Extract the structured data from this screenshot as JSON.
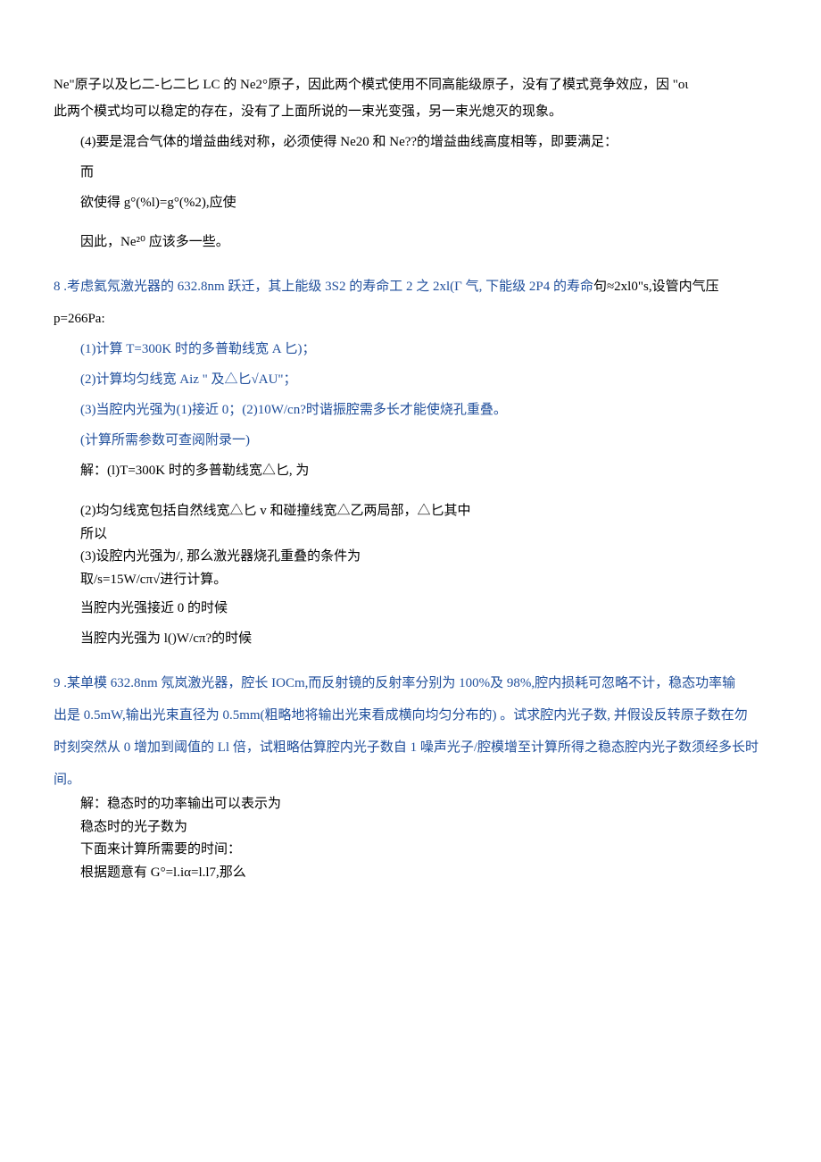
{
  "lines": {
    "l1": "Ne\"原子以及匕二-匕二匕 LC 的 Ne2°原子，因此两个模式使用不同高能级原子，没有了模式竞争效应，因 \"οι",
    "l2": "此两个模式均可以稳定的存在，没有了上面所说的一束光变强，另一束光熄灭的现象。",
    "l3": "(4)要是混合气体的增益曲线对称，必须使得 Ne20 和 Ne??的增益曲线高度相等，即要满足：",
    "l4": "而",
    "l5": "欲使得 g°(%l)=g°(%2),应使",
    "l6": "因此，Ne²⁰ 应该多一些。",
    "q8_num": "8",
    "q8_a": " .考虑氦氖激光器的 632.8nm 跃迁，其上能级 3S2 的寿命工 2 之 2xl(Γ 气, 下能级 2P4 的寿命",
    "q8_b": "句≈2xl0\"s,设管内气压",
    "q8_c": "p=266Pa:",
    "q8_1": "(1)计算 T=300K 时的多普勒线宽 A 匕)；",
    "q8_2": "(2)计算均匀线宽 Aiz \" 及△匕√AU\"；",
    "q8_3": "(3)当腔内光强为(1)接近 0；(2)10W/cn?时谐振腔需多长才能使烧孔重叠。",
    "q8_4": "(计算所需参数可查阅附录一)",
    "q8_sol1": "解：(l)T=300K 时的多普勒线宽△匕, 为",
    "q8_sol2": "(2)均匀线宽包括自然线宽△匕 v 和碰撞线宽△乙两局部，△匕其中",
    "q8_sol3": "所以",
    "q8_sol4": "(3)设腔内光强为/, 那么激光器烧孔重叠的条件为",
    "q8_sol5": "取/s=15W/cπ√进行计算。",
    "q8_sol6": "当腔内光强接近 0 的时候",
    "q8_sol7": "当腔内光强为 l()W/cπ?的时候",
    "q9_num": "9",
    "q9_a": " .某单模 632.8nm 氖岚激光器，腔长 IOCm,而反射镜的反射率分别为 100%及 98%,腔内损耗可忽略不计，稳态功率输",
    "q9_b": "出是 0.5mW,输出光束直径为 0.5mm(粗略地将输出光束看成横向均匀分布的) 。试求腔内光子数, 并假设反转原子数在勿",
    "q9_c": "时刻突然从 0 增加到阈值的 Ll 倍，试粗略估算腔内光子数自 1 噪声光子/腔模增至计算所得之稳态腔内光子数须经多长时",
    "q9_d": "间。",
    "q9_sol1": "解：稳态时的功率输出可以表示为",
    "q9_sol2": "稳态时的光子数为",
    "q9_sol3": "下面来计算所需要的时间：",
    "q9_sol4": "根据题意有 G°=l.iα=l.l7,那么"
  }
}
